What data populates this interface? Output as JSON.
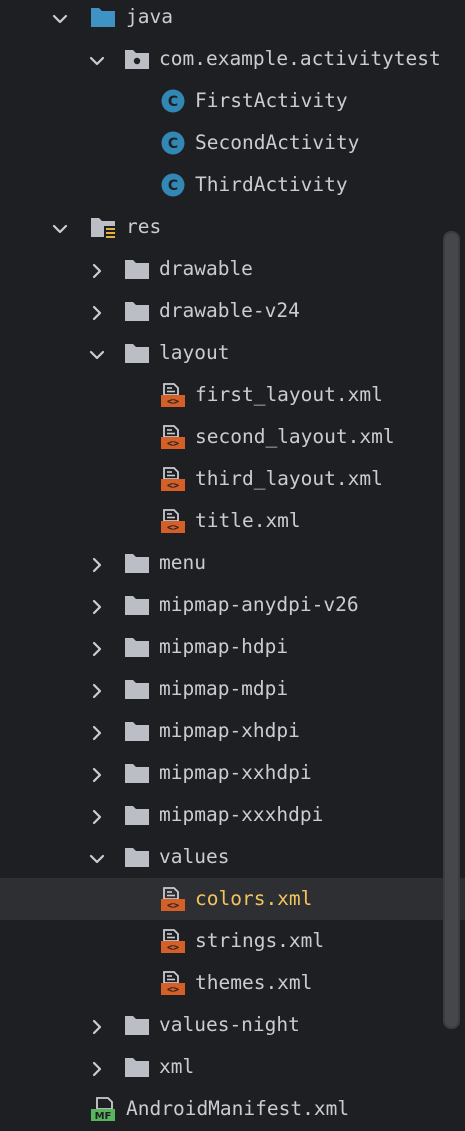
{
  "colors": {
    "background": "#1e1f22",
    "text": "#c9ccd2",
    "selected_row_bg": "#2e2f33",
    "selected_text": "#f2c55c",
    "source_folder_icon": "#3f92c4",
    "folder_icon": "#bbbec5",
    "xml_icon": "#d45f27",
    "class_icon": "#3288b5",
    "manifest_icon": "#58b45d"
  },
  "tree": [
    {
      "label": "java",
      "expander": "expanded",
      "icon": "source-folder-icon"
    },
    {
      "label": "com.example.activitytest",
      "expander": "expanded",
      "icon": "package-icon"
    },
    {
      "label": "FirstActivity",
      "expander": "none",
      "icon": "java-class-icon",
      "icon_letter": "C"
    },
    {
      "label": "SecondActivity",
      "expander": "none",
      "icon": "java-class-icon",
      "icon_letter": "C"
    },
    {
      "label": "ThirdActivity",
      "expander": "none",
      "icon": "java-class-icon",
      "icon_letter": "C"
    },
    {
      "label": "res",
      "expander": "expanded",
      "icon": "resource-folder-icon"
    },
    {
      "label": "drawable",
      "expander": "collapsed",
      "icon": "folder-icon"
    },
    {
      "label": "drawable-v24",
      "expander": "collapsed",
      "icon": "folder-icon"
    },
    {
      "label": "layout",
      "expander": "expanded",
      "icon": "folder-icon"
    },
    {
      "label": "first_layout.xml",
      "expander": "none",
      "icon": "xml-file-icon"
    },
    {
      "label": "second_layout.xml",
      "expander": "none",
      "icon": "xml-file-icon"
    },
    {
      "label": "third_layout.xml",
      "expander": "none",
      "icon": "xml-file-icon"
    },
    {
      "label": "title.xml",
      "expander": "none",
      "icon": "xml-file-icon"
    },
    {
      "label": "menu",
      "expander": "collapsed",
      "icon": "folder-icon"
    },
    {
      "label": "mipmap-anydpi-v26",
      "expander": "collapsed",
      "icon": "folder-icon"
    },
    {
      "label": "mipmap-hdpi",
      "expander": "collapsed",
      "icon": "folder-icon"
    },
    {
      "label": "mipmap-mdpi",
      "expander": "collapsed",
      "icon": "folder-icon"
    },
    {
      "label": "mipmap-xhdpi",
      "expander": "collapsed",
      "icon": "folder-icon"
    },
    {
      "label": "mipmap-xxhdpi",
      "expander": "collapsed",
      "icon": "folder-icon"
    },
    {
      "label": "mipmap-xxxhdpi",
      "expander": "collapsed",
      "icon": "folder-icon"
    },
    {
      "label": "values",
      "expander": "expanded",
      "icon": "folder-icon"
    },
    {
      "label": "colors.xml",
      "expander": "none",
      "icon": "xml-file-icon",
      "selected": true
    },
    {
      "label": "strings.xml",
      "expander": "none",
      "icon": "xml-file-icon"
    },
    {
      "label": "themes.xml",
      "expander": "none",
      "icon": "xml-file-icon"
    },
    {
      "label": "values-night",
      "expander": "collapsed",
      "icon": "folder-icon"
    },
    {
      "label": "xml",
      "expander": "collapsed",
      "icon": "folder-icon"
    },
    {
      "label": "AndroidManifest.xml",
      "expander": "none",
      "icon": "manifest-file-icon",
      "icon_text": "MF"
    }
  ]
}
